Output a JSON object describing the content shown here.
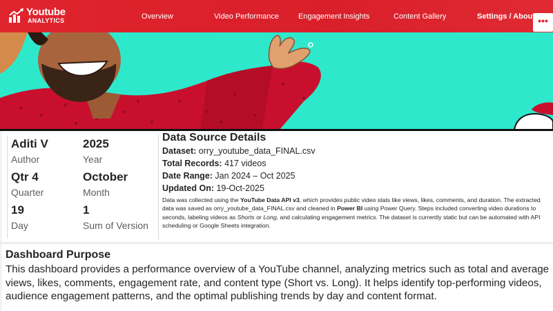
{
  "brand": {
    "line1": "Youtube",
    "line2": "ANALYTICS"
  },
  "nav": {
    "items": [
      {
        "label": "Overview"
      },
      {
        "label": "Video Performance"
      },
      {
        "label": "Engagement Insights"
      },
      {
        "label": "Content Gallery"
      },
      {
        "label": "Settings / About"
      }
    ],
    "more_icon": "more-horizontal-icon"
  },
  "colors": {
    "brand_red": "#e0242e",
    "banner_bg": "#2ee8cc"
  },
  "info": {
    "author_value": "Aditi V",
    "author_label": "Author",
    "year_value": "2025",
    "year_label": "Year",
    "quarter_value": "Qtr 4",
    "quarter_label": "Quarter",
    "month_value": "October",
    "month_label": "Month",
    "day_value": "19",
    "day_label": "Day",
    "version_value": "1",
    "version_label": "Sum of Version"
  },
  "data_source": {
    "title": "Data Source Details",
    "dataset_label": "Dataset:",
    "dataset_value": " orry_youtube_data_FINAL.csv",
    "records_label": "Total Records:",
    "records_value": " 417 videos",
    "range_label": "Date Range:",
    "range_value": " Jan 2024 – Oct 2025",
    "updated_label": "Updated On:",
    "updated_value": " 19-Oct-2025",
    "para_1": "Data was collected using the ",
    "para_api": "YouTube Data API v3",
    "para_2": ", which provides public video stats like views, likes, comments, and duration. The extracted data was saved as orry_youtube_data_FINAL.csv and cleaned in ",
    "para_pbi": "Power BI",
    "para_3": " using Power Query. Steps included converting video durations to seconds, labeling videos as ",
    "para_shorts": "Shorts",
    "para_4": " or ",
    "para_long": "Long",
    "para_5": ", and calculating engagement metrics. The dataset is currently static but can be automated with API scheduling or Google Sheets integration."
  },
  "purpose": {
    "title": "Dashboard Purpose",
    "text": "This dashboard provides a performance overview of a YouTube channel, analyzing metrics such as total and average views, likes, comments, engagement rate, and content type (Short vs. Long). It helps identify top-performing videos, audience engagement patterns, and the optimal publishing trends by day and content format."
  }
}
